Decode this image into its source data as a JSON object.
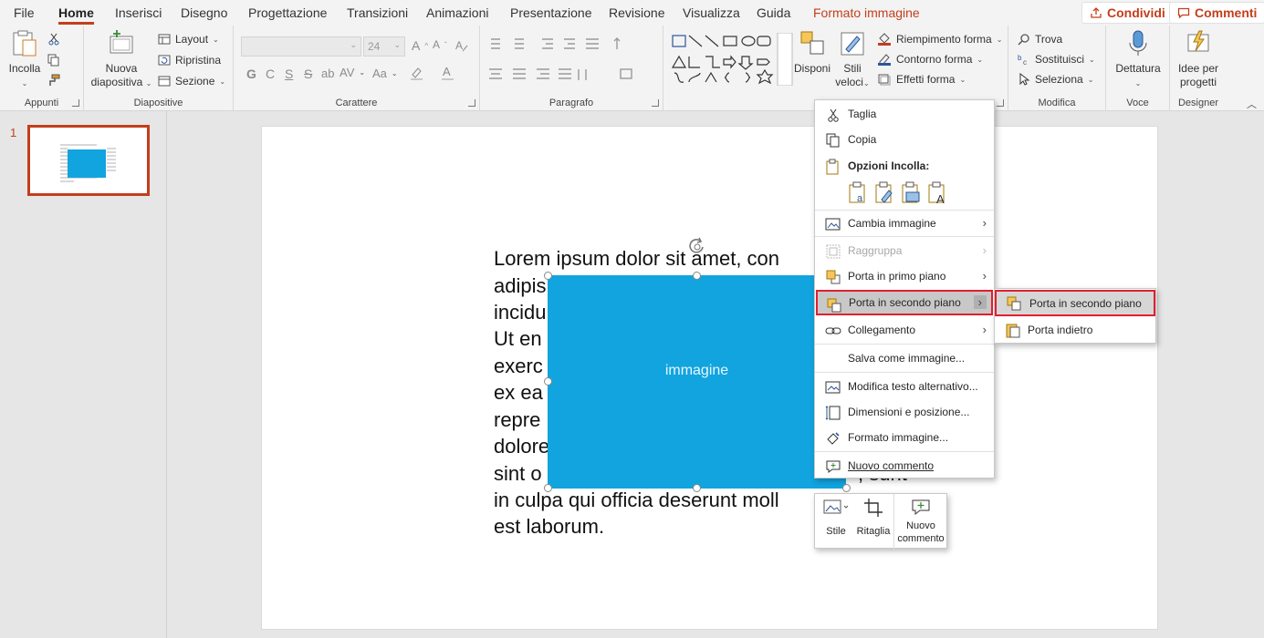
{
  "tabs": [
    "File",
    "Home",
    "Inserisci",
    "Disegno",
    "Progettazione",
    "Transizioni",
    "Animazioni",
    "Presentazione",
    "Revisione",
    "Visualizza",
    "Guida",
    "Formato immagine"
  ],
  "share_label": "Condividi",
  "comments_label": "Commenti",
  "groups": {
    "appunti": {
      "label": "Appunti",
      "incolla": "Incolla"
    },
    "diapositive": {
      "label": "Diapositive",
      "nuova1": "Nuova",
      "nuova2": "diapositiva",
      "layout": "Layout",
      "ripristina": "Ripristina",
      "sezione": "Sezione"
    },
    "carattere": {
      "label": "Carattere",
      "font_size": "24",
      "bold": "G",
      "italic": "C",
      "underline": "S",
      "strike": "S"
    },
    "paragrafo": {
      "label": "Paragrafo"
    },
    "disegno": {
      "disponi": "Disponi",
      "stili1": "Stili",
      "stili2": "veloci",
      "riempimento": "Riempimento forma",
      "contorno": "Contorno forma",
      "effetti": "Effetti forma"
    },
    "modifica": {
      "label": "Modifica",
      "trova": "Trova",
      "sostituisci": "Sostituisci",
      "seleziona": "Seleziona"
    },
    "voce": {
      "label": "Voce",
      "dettatura": "Dettatura"
    },
    "designer": {
      "label": "Designer",
      "idee1": "Idee per",
      "idee2": "progetti"
    }
  },
  "slide_number": "1",
  "slide_text": [
    "Lorem ipsum dolor sit amet, con",
    "adipis",
    "incidu",
    "Ut en",
    "exerc",
    "ex ea",
    "repre",
    "dolore",
    "sint o",
    "in culpa qui officia deserunt moll",
    "est laborum."
  ],
  "picture_label": "immagine",
  "context_menu": {
    "cut": "Taglia",
    "copy": "Copia",
    "paste_options": "Opzioni Incolla:",
    "change_picture": "Cambia immagine",
    "group": "Raggruppa",
    "bring_front": "Porta in primo piano",
    "send_back": "Porta in secondo piano",
    "link": "Collegamento",
    "save_as_picture": "Salva come immagine...",
    "alt_text": "Modifica testo alternativo...",
    "size_position": "Dimensioni e posizione...",
    "format_picture": "Formato immagine...",
    "new_comment": "Nuovo commento"
  },
  "submenu": {
    "send_to_back": "Porta in secondo piano",
    "send_backward": "Porta indietro"
  },
  "mini_toolbar": {
    "style": "Stile",
    "crop": "Ritaglia",
    "new_comment1": "Nuovo",
    "new_comment2": "commento"
  },
  "colors": {
    "accent": "#c43e1c",
    "picture": "#11a4df",
    "highlight": "#e02030"
  }
}
